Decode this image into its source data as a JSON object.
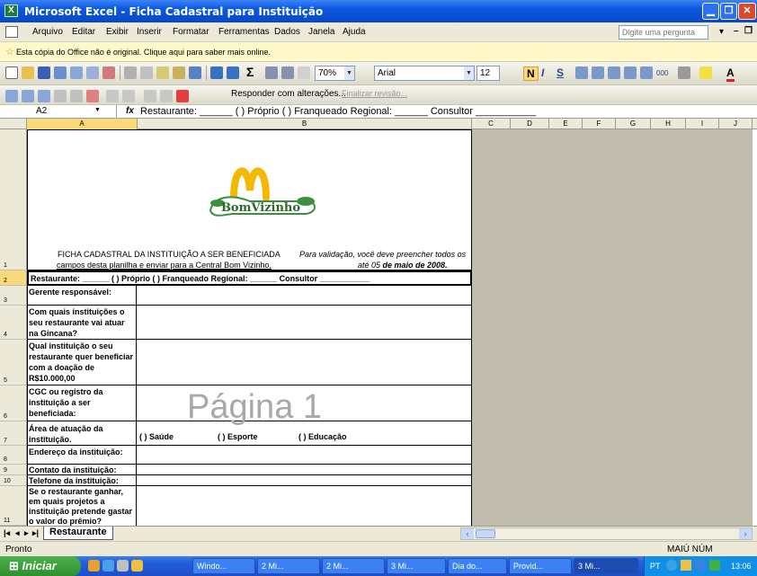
{
  "window": {
    "title": "Microsoft Excel - Ficha Cadastral para Instituição",
    "app_icon": "excel-icon",
    "controls": [
      "minimize-icon",
      "restore-icon",
      "close-icon"
    ]
  },
  "menu": {
    "items": [
      "Arquivo",
      "Editar",
      "Exibir",
      "Inserir",
      "Formatar",
      "Ferramentas",
      "Dados",
      "Janela",
      "Ajuda"
    ],
    "help_placeholder": "Digite uma pergunta"
  },
  "infobar": {
    "message": "Esta cópia do Office não é original. Clique aqui para saber mais online."
  },
  "toolbar": {
    "zoom": "70%",
    "font": "Arial",
    "font_size": "12",
    "bold": "N",
    "italic": "I",
    "underline": "S",
    "thousands": "000",
    "reply_label": "Responder com alterações...",
    "end_review_label": "Finalizar revisão..."
  },
  "formula_bar": {
    "name_box": "A2",
    "fx": "fx",
    "content": "Restaurante: ______   ( ) Próprio   ( ) Franqueado  Regional: ______   Consultor ___________"
  },
  "columns": [
    "A",
    "B",
    "C",
    "D",
    "E",
    "F",
    "G",
    "H",
    "I",
    "J"
  ],
  "rows": [
    "1",
    "2",
    "3",
    "4",
    "5",
    "6",
    "7",
    "8",
    "9",
    "10",
    "11"
  ],
  "sheet": {
    "logo_text": "BomVizinho",
    "header_left_1": "FICHA CADASTRAL DA INSTITUIÇÃO A SER BENEFICIADA",
    "header_left_2": "campos desta planilha e enviar para a Central Bom Vizinho,",
    "header_right_1": "Para validação, você deve preencher todos os",
    "header_right_2a": "até 05 ",
    "header_right_2b": "de maio de 2008.",
    "row2": "Restaurante: ______   ( ) Próprio   ( ) Franqueado  Regional: ______   Consultor ___________",
    "labels": [
      "Gerente responsável:",
      "Com quais instituições o seu restaurante vai atuar na Gincana?",
      "Qual instituição o seu restaurante quer beneficiar com a doação de R$10.000,00",
      "CGC ou registro da instituição a ser beneficiada:",
      "Área de atuação da instituição.",
      "Endereço da instituição:",
      "Contato da instituição:",
      "Telefone da instituição:",
      "Se o restaurante ganhar, em quais projetos a instituição pretende gastar o valor do prêmio?"
    ],
    "area_options": [
      "( ) Saúde",
      "( ) Esporte",
      "( ) Educação"
    ],
    "watermark": "Página 1",
    "tab_name": "Restaurante"
  },
  "status": {
    "left": "Pronto",
    "right": "MAIÚ NÚM"
  },
  "taskbar": {
    "start": "Iniciar",
    "tasks": [
      "Windo...",
      "2 Mi...",
      "2 Mi...",
      "3 Mi...",
      "Dia do...",
      "Provid...",
      "3 Mi..."
    ],
    "lang": "PT",
    "clock": "13:06"
  },
  "colors": {
    "title_blue": "#0a58e0",
    "excel_green": "#1e7b3a",
    "mcd_yellow": "#f5b800",
    "logo_green": "#3c8f3c"
  }
}
